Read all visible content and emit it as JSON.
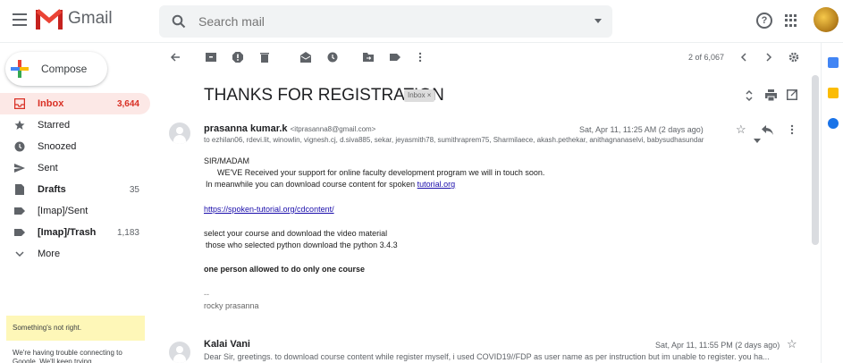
{
  "header": {
    "app_name": "Gmail",
    "search_placeholder": "Search mail"
  },
  "sidebar": {
    "compose_label": "Compose",
    "items": [
      {
        "label": "Inbox",
        "count": "3,644"
      },
      {
        "label": "Starred",
        "count": ""
      },
      {
        "label": "Snoozed",
        "count": ""
      },
      {
        "label": "Sent",
        "count": ""
      },
      {
        "label": "Drafts",
        "count": "35"
      },
      {
        "label": "[Imap]/Sent",
        "count": ""
      },
      {
        "label": "[Imap]/Trash",
        "count": "1,183"
      },
      {
        "label": "More",
        "count": ""
      }
    ],
    "warning_title": "Something's not right.",
    "warning_body": "We're having trouble connecting to Google. We'll keep trying..."
  },
  "toolbar": {
    "page_info": "2 of 6,067"
  },
  "thread": {
    "subject": "THANKS FOR REGISTRATION",
    "label_tag": "Inbox ×",
    "messages": [
      {
        "sender": "prasanna kumar.k",
        "email": "<itprasanna8@gmail.com>",
        "date": "Sat, Apr 11, 11:25 AM (2 days ago)",
        "to": "to ezhilan06, rdevi.lit, winowlin, vignesh.cj, d.siva885, sekar, jeyasmith78, sumithraprem75, Sharmilaece, akash.pethekar, anithagnanaselvi, babysudhasundar",
        "body": {
          "l1": "SIR/MADAM",
          "l2": "WE'VE Received your support for online faculty development program we will in touch soon.",
          "l3": "In meanwhile you can download course content for spoken ",
          "l3_link": "tutorial.org",
          "link": "https://spoken-tutorial.org/cdcontent/",
          "l4": "select your course and download the video material",
          "l5": "those who selected python download the python 3.4.3",
          "l6": "one person allowed to do only one course",
          "sig_dash": "--",
          "signature": "rocky prasanna"
        }
      },
      {
        "sender": "Kalai Vani",
        "date": "Sat, Apr 11, 11:55 PM (2 days ago)",
        "snippet": "Dear Sir, greetings. to download course content while register myself, i used COVID19//FDP as user name as per instruction but im unable to register. you ha..."
      }
    ]
  },
  "colors": {
    "accent_red": "#d93025",
    "inbox_active_bg": "#fce8e6",
    "warning_bg": "#fef7b8",
    "link": "#1a0dab"
  }
}
